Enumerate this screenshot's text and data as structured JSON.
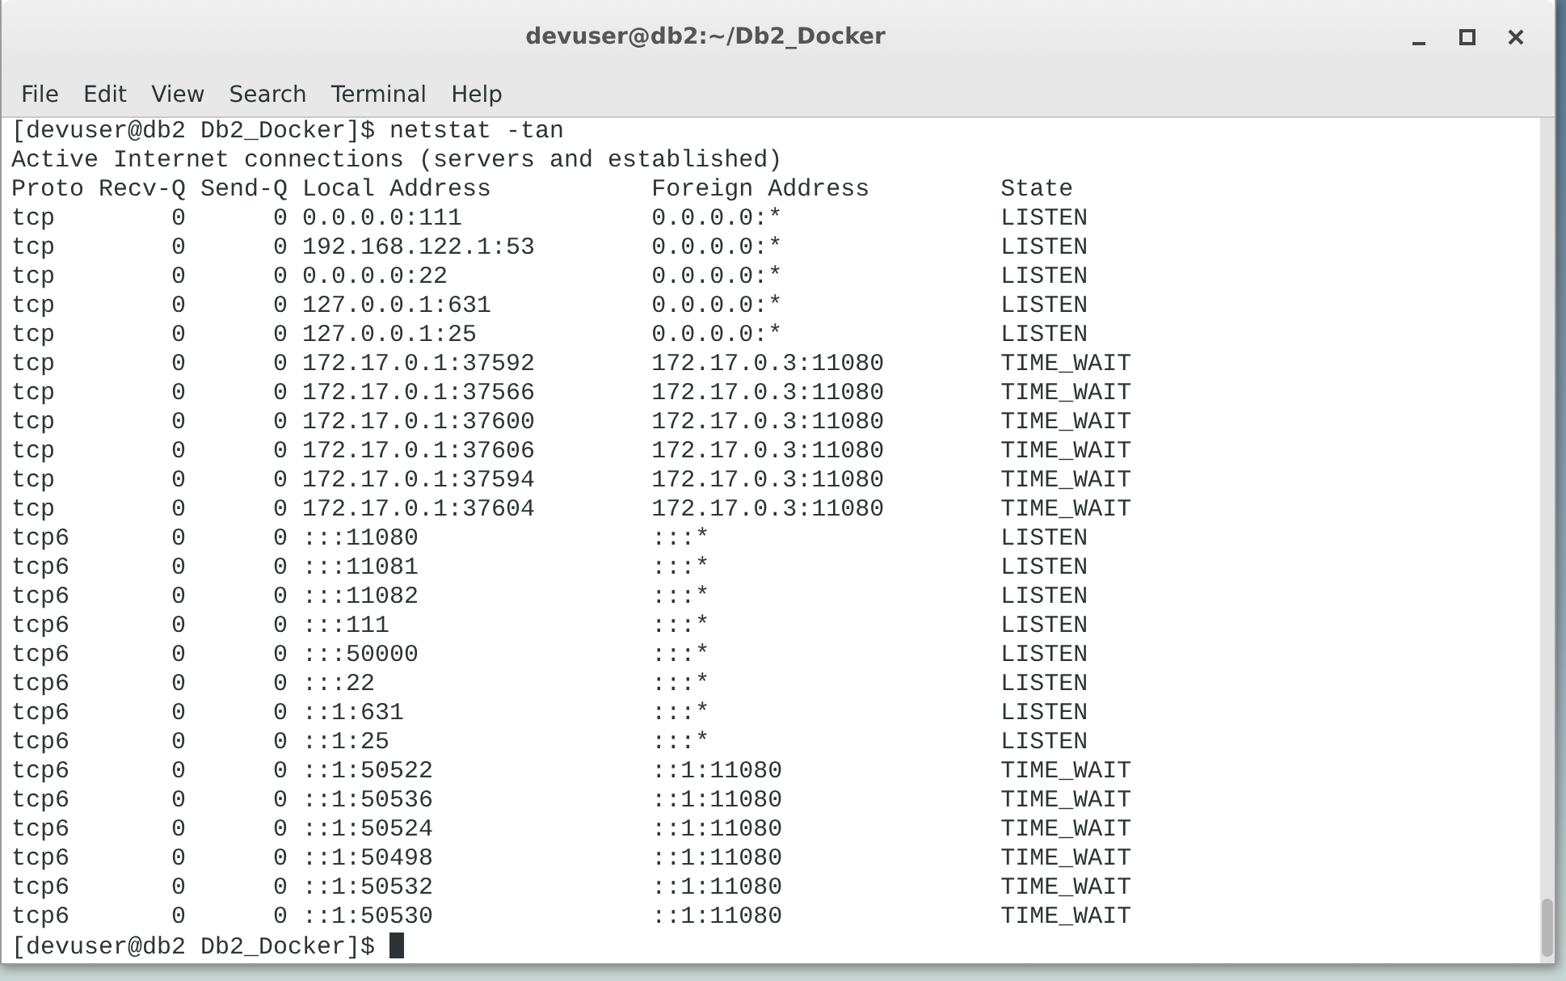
{
  "window": {
    "title": "devuser@db2:~/Db2_Docker"
  },
  "menu": [
    "File",
    "Edit",
    "View",
    "Search",
    "Terminal",
    "Help"
  ],
  "terminal": {
    "lines": [
      "[devuser@db2 Db2_Docker]$ netstat -tan",
      "Active Internet connections (servers and established)",
      "Proto Recv-Q Send-Q Local Address           Foreign Address         State",
      "tcp        0      0 0.0.0.0:111             0.0.0.0:*               LISTEN",
      "tcp        0      0 192.168.122.1:53        0.0.0.0:*               LISTEN",
      "tcp        0      0 0.0.0.0:22              0.0.0.0:*               LISTEN",
      "tcp        0      0 127.0.0.1:631           0.0.0.0:*               LISTEN",
      "tcp        0      0 127.0.0.1:25            0.0.0.0:*               LISTEN",
      "tcp        0      0 172.17.0.1:37592        172.17.0.3:11080        TIME_WAIT",
      "tcp        0      0 172.17.0.1:37566        172.17.0.3:11080        TIME_WAIT",
      "tcp        0      0 172.17.0.1:37600        172.17.0.3:11080        TIME_WAIT",
      "tcp        0      0 172.17.0.1:37606        172.17.0.3:11080        TIME_WAIT",
      "tcp        0      0 172.17.0.1:37594        172.17.0.3:11080        TIME_WAIT",
      "tcp        0      0 172.17.0.1:37604        172.17.0.3:11080        TIME_WAIT",
      "tcp6       0      0 :::11080                :::*                    LISTEN",
      "tcp6       0      0 :::11081                :::*                    LISTEN",
      "tcp6       0      0 :::11082                :::*                    LISTEN",
      "tcp6       0      0 :::111                  :::*                    LISTEN",
      "tcp6       0      0 :::50000                :::*                    LISTEN",
      "tcp6       0      0 :::22                   :::*                    LISTEN",
      "tcp6       0      0 ::1:631                 :::*                    LISTEN",
      "tcp6       0      0 ::1:25                  :::*                    LISTEN",
      "tcp6       0      0 ::1:50522               ::1:11080               TIME_WAIT",
      "tcp6       0      0 ::1:50536               ::1:11080               TIME_WAIT",
      "tcp6       0      0 ::1:50524               ::1:11080               TIME_WAIT",
      "tcp6       0      0 ::1:50498               ::1:11080               TIME_WAIT",
      "tcp6       0      0 ::1:50532               ::1:11080               TIME_WAIT",
      "tcp6       0      0 ::1:50530               ::1:11080               TIME_WAIT"
    ],
    "prompt": "[devuser@db2 Db2_Docker]$ "
  }
}
